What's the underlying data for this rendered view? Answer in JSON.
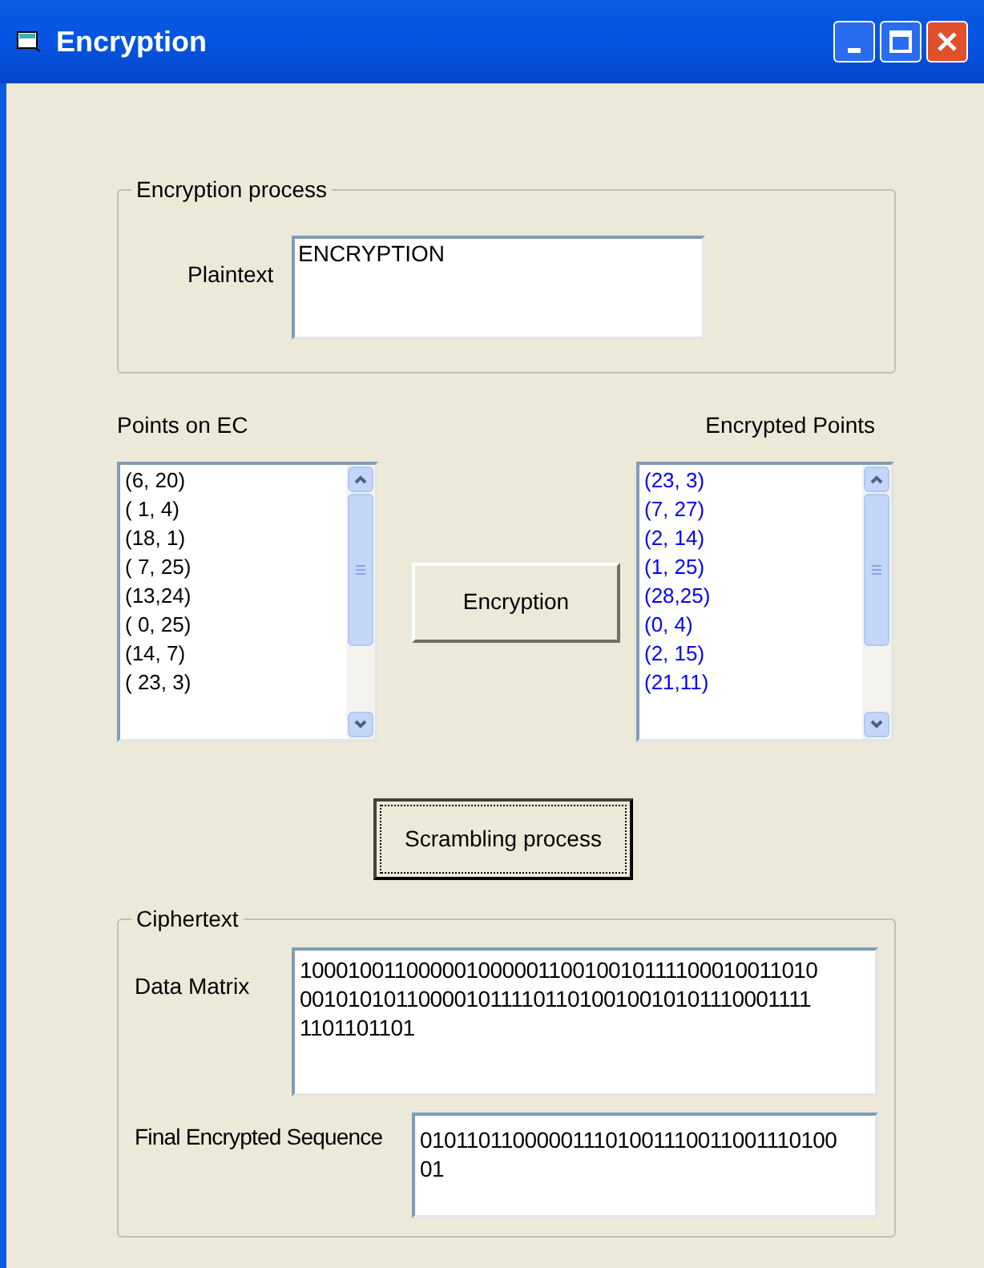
{
  "window": {
    "title": "Encryption"
  },
  "encryption_process": {
    "title": "Encryption process",
    "plaintext_label": "Plaintext",
    "plaintext_value": "ENCRYPTION"
  },
  "points_on_ec": {
    "label": "Points on EC",
    "items": [
      "(6, 20)",
      "( 1, 4)",
      "(18, 1)",
      "( 7, 25)",
      "(13,24)",
      "( 0, 25)",
      "(14, 7)",
      "( 23, 3)"
    ]
  },
  "encryption_button": "Encryption",
  "encrypted_points": {
    "label": "Encrypted Points",
    "items": [
      "(23, 3)",
      "(7, 27)",
      "(2, 14)",
      "(1, 25)",
      "(28,25)",
      "(0, 4)",
      "(2, 15)",
      "(21,11)"
    ]
  },
  "scrambling_button": "Scrambling process",
  "ciphertext": {
    "title": "Ciphertext",
    "data_matrix_label": "Data Matrix",
    "data_matrix_value": "10001001100000100000110010010111100010011010001010101100001011110110100100101011100011111101101101",
    "final_label": "Final Encrypted Sequence",
    "final_value": "01011011000001110100111001100111010001"
  }
}
